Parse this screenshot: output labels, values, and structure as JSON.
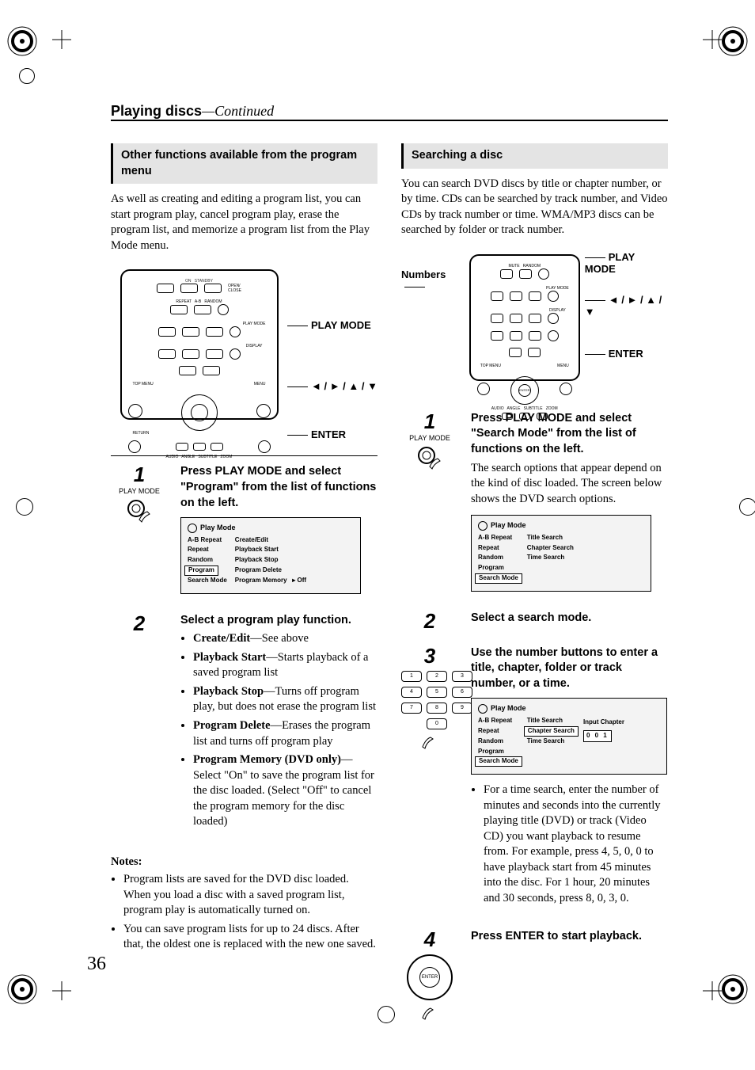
{
  "header": {
    "section": "Playing discs",
    "continued": "—Continued"
  },
  "left": {
    "heading": "Other functions available from the program menu",
    "intro": "As well as creating and editing a program list, you can start program play, cancel program play, erase the program list, and memorize a program list from the Play Mode menu.",
    "remote_labels": {
      "play_mode": "PLAY MODE",
      "arrows": "◄ / ► / ▲ / ▼",
      "enter": "ENTER"
    },
    "step1": {
      "num": "1",
      "caption": "PLAY MODE",
      "lead": "Press PLAY MODE and select \"Program\" from the list of functions on the left.",
      "osd": {
        "title": "Play Mode",
        "left": [
          "A-B Repeat",
          "Repeat",
          "Random",
          "Program",
          "Search Mode"
        ],
        "left_highlight_index": 3,
        "right": [
          "Create/Edit",
          "Playback Start",
          "Playback Stop",
          "Program Delete",
          "Program Memory"
        ],
        "memory_value": "Off"
      }
    },
    "step2": {
      "num": "2",
      "lead": "Select a program play function.",
      "items": [
        {
          "b": "Create/Edit",
          "t": "—See above"
        },
        {
          "b": "Playback Start",
          "t": "—Starts playback of a saved program list"
        },
        {
          "b": "Playback Stop",
          "t": "—Turns off program play, but does not erase the program list"
        },
        {
          "b": "Program Delete",
          "t": "—Erases the program list and turns off program play"
        },
        {
          "b": "Program Memory (DVD only)",
          "t": "—Select \"On\" to save the program list for the disc loaded. (Select \"Off\" to cancel the program memory for the disc loaded)"
        }
      ]
    },
    "notes_head": "Notes:",
    "notes": [
      "Program lists are saved for the DVD disc loaded. When you load a disc with a saved program list, program play is automatically turned on.",
      "You can save program lists for up to 24 discs. After that, the oldest one is replaced with the new one saved."
    ]
  },
  "right": {
    "heading": "Searching a disc",
    "intro": "You can search DVD discs by title or chapter number, or by time. CDs can be searched by track number, and Video CDs by track number or time. WMA/MP3 discs can be searched by folder or track number.",
    "remote_labels": {
      "numbers": "Numbers",
      "play_mode": "PLAY MODE",
      "arrows": "◄ / ► / ▲ / ▼",
      "enter": "ENTER"
    },
    "step1": {
      "num": "1",
      "caption": "PLAY MODE",
      "lead": "Press PLAY MODE and select \"Search Mode\" from the list of functions on the left.",
      "after": "The search options that appear depend on the kind of disc loaded. The screen below shows the DVD search options.",
      "osd": {
        "title": "Play Mode",
        "left": [
          "A-B Repeat",
          "Repeat",
          "Random",
          "Program",
          "Search Mode"
        ],
        "left_highlight_index": 4,
        "right": [
          "Title Search",
          "Chapter Search",
          "Time Search"
        ]
      }
    },
    "step2": {
      "num": "2",
      "lead": "Select a search mode."
    },
    "step3": {
      "num": "3",
      "lead": "Use the number buttons to enter a title, chapter, folder or track number, or a time.",
      "keypad": [
        "1",
        "2",
        "3",
        "4",
        "5",
        "6",
        "7",
        "8",
        "9",
        "0"
      ],
      "osd": {
        "title": "Play Mode",
        "left": [
          "A-B Repeat",
          "Repeat",
          "Random",
          "Program",
          "Search Mode"
        ],
        "left_highlight_index": 4,
        "right": [
          "Title Search",
          "Chapter Search",
          "Time Search"
        ],
        "right_highlight_index": 1,
        "input_label": "Input Chapter",
        "input_value": "0 0 1"
      },
      "note": "For a time search, enter the number of minutes and seconds into the currently playing title (DVD) or track (Video CD) you want playback to resume from. For example, press 4, 5, 0, 0 to have playback start from 45 minutes into the disc. For 1 hour, 20 minutes and 30 seconds, press 8, 0, 3, 0."
    },
    "step4": {
      "num": "4",
      "lead": "Press ENTER to start playback.",
      "enter_label": "ENTER"
    }
  },
  "page_number": "36"
}
